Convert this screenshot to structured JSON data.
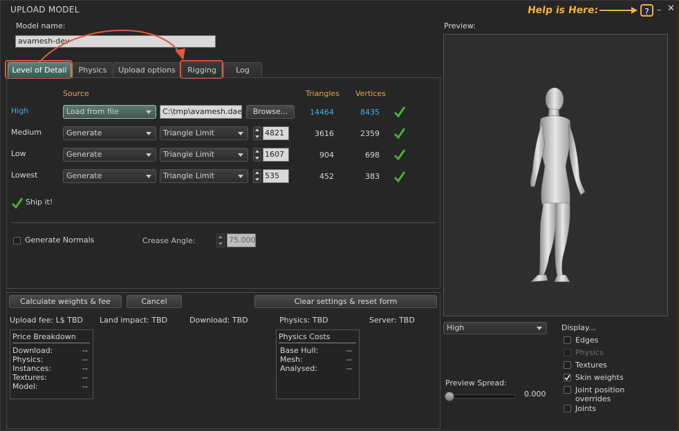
{
  "window": {
    "title": "UPLOAD MODEL",
    "help_annotation": "Help is Here:",
    "help_button": "?",
    "minimize_glyph": "–",
    "close_glyph": "✕"
  },
  "model_name": {
    "label": "Model name:",
    "value": "avamesh-dev"
  },
  "tabs": [
    {
      "label": "Level of Detail",
      "active": true,
      "highlighted": true
    },
    {
      "label": "Physics",
      "active": false
    },
    {
      "label": "Upload options",
      "active": false
    },
    {
      "label": "Rigging",
      "active": false,
      "highlighted": true
    },
    {
      "label": "Log",
      "active": false
    }
  ],
  "lod": {
    "headers": {
      "source": "Source",
      "triangles": "Triangles",
      "vertices": "Vertices"
    },
    "rows": [
      {
        "name": "High",
        "source": "Load from file",
        "file": "C:\\tmp\\avamesh.dae",
        "browse": "Browse...",
        "triangles": "14464",
        "vertices": "8435",
        "ok": true
      },
      {
        "name": "Medium",
        "source": "Generate",
        "method": "Triangle Limit",
        "limit": "4821",
        "triangles": "3616",
        "vertices": "2359",
        "ok": true
      },
      {
        "name": "Low",
        "source": "Generate",
        "method": "Triangle Limit",
        "limit": "1607",
        "triangles": "904",
        "vertices": "698",
        "ok": true
      },
      {
        "name": "Lowest",
        "source": "Generate",
        "method": "Triangle Limit",
        "limit": "535",
        "triangles": "452",
        "vertices": "383",
        "ok": true
      }
    ],
    "ship_it": "Ship it!",
    "generate_normals": "Generate Normals",
    "crease_angle_label": "Crease Angle:",
    "crease_angle_value": "75.000"
  },
  "actions": {
    "calculate": "Calculate weights & fee",
    "cancel": "Cancel",
    "clear": "Clear settings & reset form"
  },
  "fees": {
    "upload_fee": "Upload fee: L$ TBD",
    "land_impact": "Land impact: TBD",
    "download": "Download: TBD",
    "physics": "Physics: TBD",
    "server": "Server: TBD"
  },
  "price_breakdown": {
    "title": "Price Breakdown",
    "items": [
      {
        "label": "Download:",
        "value": "--"
      },
      {
        "label": "Physics:",
        "value": "--"
      },
      {
        "label": "Instances:",
        "value": "--"
      },
      {
        "label": "Textures:",
        "value": "--"
      },
      {
        "label": "Model:",
        "value": "--"
      }
    ]
  },
  "physics_costs": {
    "title": "Physics Costs",
    "items": [
      {
        "label": "Base Hull:",
        "value": "--"
      },
      {
        "label": "Mesh:",
        "value": "--"
      },
      {
        "label": "Analysed:",
        "value": "--"
      }
    ]
  },
  "preview": {
    "label": "Preview:",
    "lod_select": "High",
    "display_label": "Display...",
    "options": [
      {
        "label": "Edges",
        "checked": false,
        "enabled": true
      },
      {
        "label": "Physics",
        "checked": false,
        "enabled": false
      },
      {
        "label": "Textures",
        "checked": false,
        "enabled": true
      },
      {
        "label": "Skin weights",
        "checked": true,
        "enabled": true
      },
      {
        "label": "Joint position overrides",
        "checked": false,
        "enabled": true
      },
      {
        "label": "Joints",
        "checked": false,
        "enabled": true
      }
    ],
    "spread_label": "Preview Spread:",
    "spread_value": "0.000",
    "spread_fraction": 0.0
  },
  "colors": {
    "accent_orange": "#e8a24a",
    "high_blue": "#3fb4e8",
    "annotation_red": "#e8563a",
    "help_yellow": "#f3b23a",
    "check_green": "#46b22e"
  }
}
